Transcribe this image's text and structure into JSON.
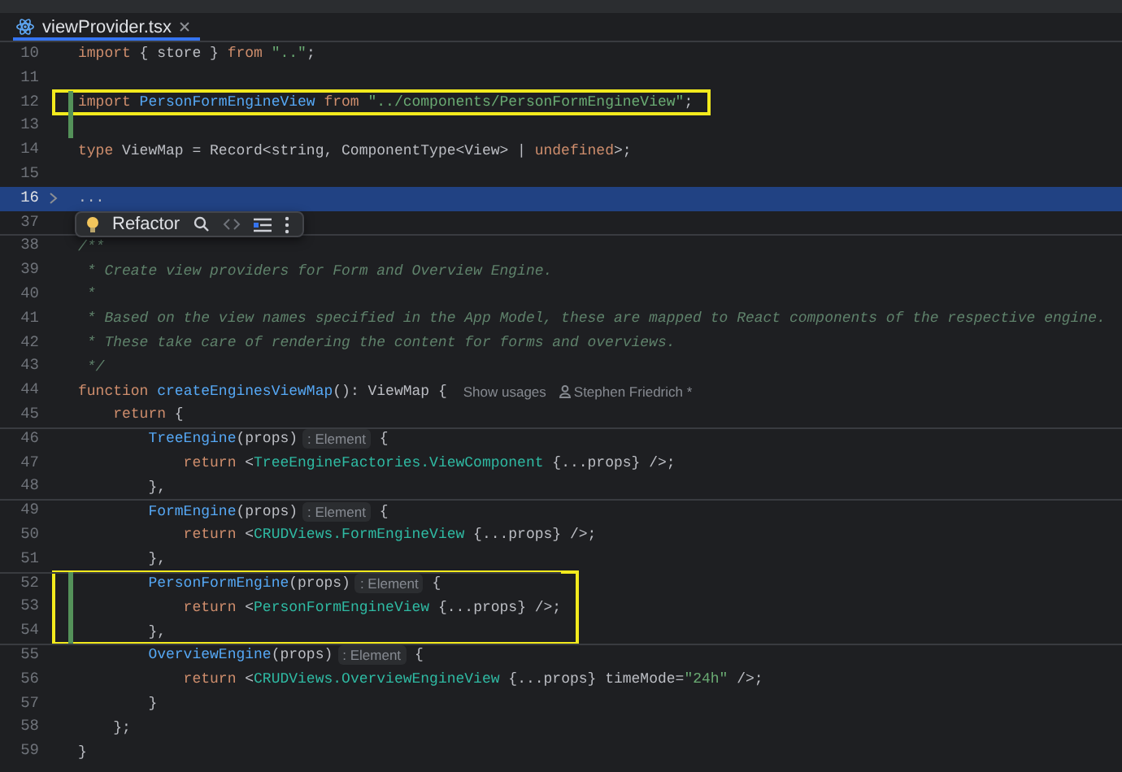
{
  "tab": {
    "label": "viewProvider.tsx"
  },
  "intention_popup": {
    "label": "Refactor"
  },
  "lines": [
    {
      "number": "10",
      "boxed": false,
      "changed": false,
      "selected": false,
      "folded": false,
      "separator_above": false,
      "tokens": [
        {
          "kind": "keyword",
          "text": "import"
        },
        {
          "kind": "plain",
          "text": " { store } "
        },
        {
          "kind": "keyword",
          "text": "from"
        },
        {
          "kind": "string",
          "text": " \"..\""
        },
        {
          "kind": "plain",
          "text": ";"
        }
      ]
    },
    {
      "number": "11",
      "boxed": false,
      "changed": false,
      "selected": false,
      "folded": false,
      "separator_above": false
    },
    {
      "number": "12",
      "boxed": true,
      "changed": true,
      "selected": false,
      "folded": false,
      "separator_above": false,
      "tokens": [
        {
          "kind": "keyword",
          "text": "import"
        },
        {
          "kind": "function",
          "text": " PersonFormEngineView"
        },
        {
          "kind": "keyword",
          "text": " from"
        },
        {
          "kind": "string",
          "text": " \"../components/PersonFormEngineView\""
        },
        {
          "kind": "plain",
          "text": ";"
        }
      ]
    },
    {
      "number": "13",
      "boxed": false,
      "changed": true,
      "selected": false,
      "folded": false,
      "separator_above": false
    },
    {
      "number": "14",
      "boxed": false,
      "changed": false,
      "selected": false,
      "folded": false,
      "separator_above": false,
      "tokens": [
        {
          "kind": "keyword",
          "text": "type"
        },
        {
          "kind": "plain",
          "text": " ViewMap = Record<string, ComponentType<View> | "
        },
        {
          "kind": "keyword",
          "text": "undefined"
        },
        {
          "kind": "plain",
          "text": ">;"
        }
      ]
    },
    {
      "number": "15",
      "boxed": false,
      "changed": false,
      "selected": false,
      "folded": false,
      "separator_above": false
    },
    {
      "number": "16",
      "boxed": false,
      "changed": false,
      "selected": true,
      "folded": true,
      "separator_above": false,
      "tokens": [
        {
          "kind": "plain",
          "text": "..."
        }
      ]
    },
    {
      "number": "37",
      "boxed": false,
      "changed": false,
      "selected": false,
      "folded": false,
      "separator_above": false
    },
    {
      "number": "38",
      "boxed": false,
      "changed": false,
      "selected": false,
      "folded": false,
      "separator_above": true,
      "tokens": [
        {
          "kind": "comment",
          "text": "/**"
        }
      ]
    },
    {
      "number": "39",
      "boxed": false,
      "changed": false,
      "selected": false,
      "folded": false,
      "separator_above": false,
      "tokens": [
        {
          "kind": "comment",
          "text": " * Create view providers for Form and Overview Engine."
        }
      ]
    },
    {
      "number": "40",
      "boxed": false,
      "changed": false,
      "selected": false,
      "folded": false,
      "separator_above": false,
      "tokens": [
        {
          "kind": "comment",
          "text": " *"
        }
      ]
    },
    {
      "number": "41",
      "boxed": false,
      "changed": false,
      "selected": false,
      "folded": false,
      "separator_above": false,
      "tokens": [
        {
          "kind": "comment",
          "text": " * Based on the view names specified in the App Model, these are mapped to React components of the respective engine."
        }
      ]
    },
    {
      "number": "42",
      "boxed": false,
      "changed": false,
      "selected": false,
      "folded": false,
      "separator_above": false,
      "tokens": [
        {
          "kind": "comment",
          "text": " * These take care of rendering the content for forms and overviews."
        }
      ]
    },
    {
      "number": "43",
      "boxed": false,
      "changed": false,
      "selected": false,
      "folded": false,
      "separator_above": false,
      "tokens": [
        {
          "kind": "comment",
          "text": " */"
        }
      ]
    },
    {
      "number": "44",
      "boxed": false,
      "changed": false,
      "selected": false,
      "folded": false,
      "separator_above": false,
      "tokens": [
        {
          "kind": "keyword",
          "text": "function"
        },
        {
          "kind": "function",
          "text": " createEnginesViewMap"
        },
        {
          "kind": "plain",
          "text": "(): ViewMap {"
        },
        {
          "kind": "usages",
          "text": "Show usages"
        },
        {
          "kind": "author",
          "text": "Stephen Friedrich *"
        }
      ]
    },
    {
      "number": "45",
      "boxed": false,
      "changed": false,
      "selected": false,
      "folded": false,
      "separator_above": false,
      "tokens": [
        {
          "kind": "keyword",
          "text": "    return"
        },
        {
          "kind": "plain",
          "text": " {"
        }
      ]
    },
    {
      "number": "46",
      "boxed": false,
      "changed": false,
      "selected": false,
      "folded": false,
      "separator_above": true,
      "tokens": [
        {
          "kind": "function",
          "text": "        TreeEngine"
        },
        {
          "kind": "plain",
          "text": "(props)"
        },
        {
          "kind": "hint",
          "text": ": Element"
        },
        {
          "kind": "plain",
          "text": " {"
        }
      ]
    },
    {
      "number": "47",
      "boxed": false,
      "changed": false,
      "selected": false,
      "folded": false,
      "separator_above": false,
      "tokens": [
        {
          "kind": "keyword",
          "text": "            return"
        },
        {
          "kind": "plain",
          "text": " <"
        },
        {
          "kind": "tag",
          "text": "TreeEngineFactories.ViewComponent"
        },
        {
          "kind": "plain",
          "text": " {...props} />;"
        }
      ]
    },
    {
      "number": "48",
      "boxed": false,
      "changed": false,
      "selected": false,
      "folded": false,
      "separator_above": false,
      "tokens": [
        {
          "kind": "plain",
          "text": "        },"
        }
      ]
    },
    {
      "number": "49",
      "boxed": false,
      "changed": false,
      "selected": false,
      "folded": false,
      "separator_above": true,
      "tokens": [
        {
          "kind": "function",
          "text": "        FormEngine"
        },
        {
          "kind": "plain",
          "text": "(props)"
        },
        {
          "kind": "hint",
          "text": ": Element"
        },
        {
          "kind": "plain",
          "text": " {"
        }
      ]
    },
    {
      "number": "50",
      "boxed": false,
      "changed": false,
      "selected": false,
      "folded": false,
      "separator_above": false,
      "tokens": [
        {
          "kind": "keyword",
          "text": "            return"
        },
        {
          "kind": "plain",
          "text": " <"
        },
        {
          "kind": "tag",
          "text": "CRUDViews.FormEngineView"
        },
        {
          "kind": "plain",
          "text": " {...props} />;"
        }
      ]
    },
    {
      "number": "51",
      "boxed": false,
      "changed": false,
      "selected": false,
      "folded": false,
      "separator_above": false,
      "tokens": [
        {
          "kind": "plain",
          "text": "        },"
        }
      ]
    },
    {
      "number": "52",
      "boxed": true,
      "changed": true,
      "selected": false,
      "folded": false,
      "separator_above": true,
      "tokens": [
        {
          "kind": "function",
          "text": "        PersonFormEngine"
        },
        {
          "kind": "plain",
          "text": "(props)"
        },
        {
          "kind": "hint",
          "text": ": Element"
        },
        {
          "kind": "plain",
          "text": " {"
        }
      ]
    },
    {
      "number": "53",
      "boxed": true,
      "changed": true,
      "selected": false,
      "folded": false,
      "separator_above": false,
      "tokens": [
        {
          "kind": "keyword",
          "text": "            return"
        },
        {
          "kind": "plain",
          "text": " <"
        },
        {
          "kind": "tag",
          "text": "PersonFormEngineView"
        },
        {
          "kind": "plain",
          "text": " {...props} />;"
        }
      ]
    },
    {
      "number": "54",
      "boxed": true,
      "changed": true,
      "selected": false,
      "folded": false,
      "separator_above": false,
      "tokens": [
        {
          "kind": "plain",
          "text": "        },"
        }
      ]
    },
    {
      "number": "55",
      "boxed": false,
      "changed": false,
      "selected": false,
      "folded": false,
      "separator_above": true,
      "tokens": [
        {
          "kind": "function",
          "text": "        OverviewEngine"
        },
        {
          "kind": "plain",
          "text": "(props)"
        },
        {
          "kind": "hint",
          "text": ": Element"
        },
        {
          "kind": "plain",
          "text": " {"
        }
      ]
    },
    {
      "number": "56",
      "boxed": false,
      "changed": false,
      "selected": false,
      "folded": false,
      "separator_above": false,
      "tokens": [
        {
          "kind": "keyword",
          "text": "            return"
        },
        {
          "kind": "plain",
          "text": " <"
        },
        {
          "kind": "tag",
          "text": "CRUDViews.OverviewEngineView"
        },
        {
          "kind": "plain",
          "text": " {...props} timeMode="
        },
        {
          "kind": "string",
          "text": "\"24h\""
        },
        {
          "kind": "plain",
          "text": " />;"
        }
      ]
    },
    {
      "number": "57",
      "boxed": false,
      "changed": false,
      "selected": false,
      "folded": false,
      "separator_above": false,
      "tokens": [
        {
          "kind": "plain",
          "text": "        }"
        }
      ]
    },
    {
      "number": "58",
      "boxed": false,
      "changed": false,
      "selected": false,
      "folded": false,
      "separator_above": false,
      "tokens": [
        {
          "kind": "plain",
          "text": "    };"
        }
      ]
    },
    {
      "number": "59",
      "boxed": false,
      "changed": false,
      "selected": false,
      "folded": false,
      "separator_above": false,
      "tokens": [
        {
          "kind": "plain",
          "text": "}"
        }
      ]
    }
  ]
}
